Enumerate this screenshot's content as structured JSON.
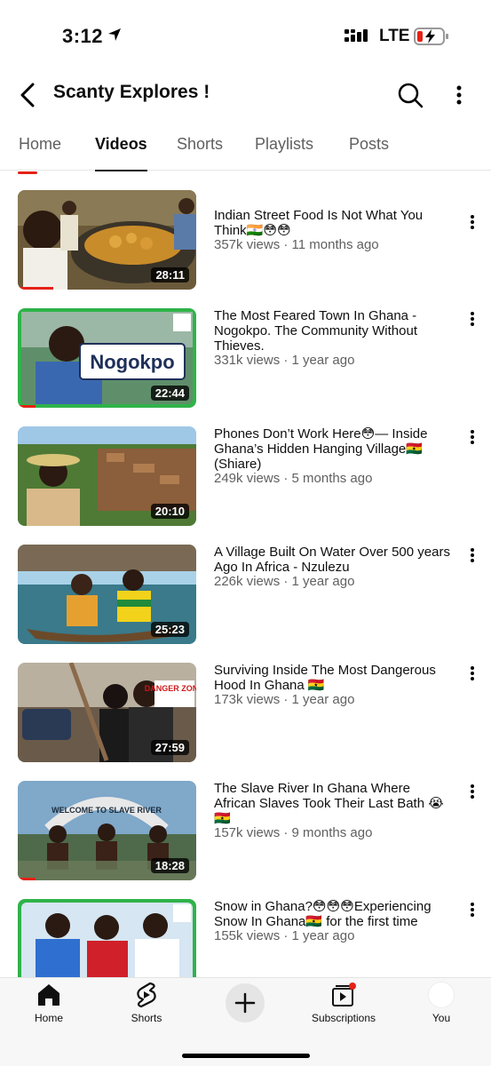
{
  "status": {
    "time": "3:12",
    "network": "LTE"
  },
  "header": {
    "title": "Scanty Explores !"
  },
  "tabs": [
    {
      "label": "Home"
    },
    {
      "label": "Videos"
    },
    {
      "label": "Shorts"
    },
    {
      "label": "Playlists"
    },
    {
      "label": "Posts"
    }
  ],
  "active_tab": "Videos",
  "videos": [
    {
      "title": "Indian Street Food Is Not What You Think🇮🇳😳😳",
      "meta": "357k views · 11 months ago",
      "duration": "28:11",
      "watched": 0.2
    },
    {
      "title": "The Most Feared Town In Ghana - Nogokpo. The Community Without Thieves.",
      "meta": "331k views · 1 year ago",
      "duration": "22:44",
      "watched": 0.1,
      "thumb_text": "Nogokpo"
    },
    {
      "title": "Phones Don’t Work Here😳— Inside Ghana’s Hidden Hanging Village🇬🇭 (Shiare)",
      "meta": "249k views · 5 months ago",
      "duration": "20:10",
      "watched": 0.0
    },
    {
      "title": "A Village Built On Water Over 500 years Ago In Africa - Nzulezu",
      "meta": "226k views · 1 year ago",
      "duration": "25:23",
      "watched": 0.0
    },
    {
      "title": "Surviving Inside The Most Dangerous Hood In Ghana 🇬🇭",
      "meta": "173k views · 1 year ago",
      "duration": "27:59",
      "watched": 0.0,
      "thumb_text": "DANGER ZONE"
    },
    {
      "title": "The Slave River In Ghana Where African Slaves Took Their Last Bath 😭🇬🇭",
      "meta": "157k views · 9 months ago",
      "duration": "18:28",
      "watched": 0.1,
      "thumb_text": "WELCOME TO SLAVE RIVER"
    },
    {
      "title": "Snow in Ghana?😳😳😳Experiencing Snow In Ghana🇬🇭 for the first time",
      "meta": "155k views · 1 year ago",
      "duration": "",
      "watched": 0.0
    }
  ],
  "bottom_nav": [
    {
      "label": "Home",
      "icon": "home-icon"
    },
    {
      "label": "Shorts",
      "icon": "shorts-icon"
    },
    {
      "label": "",
      "icon": "plus-icon"
    },
    {
      "label": "Subscriptions",
      "icon": "subscriptions-icon"
    },
    {
      "label": "You",
      "icon": "avatar"
    }
  ],
  "colors": {
    "accent": "#e62117",
    "text": "#0f0f0f",
    "secondary": "#606060"
  }
}
